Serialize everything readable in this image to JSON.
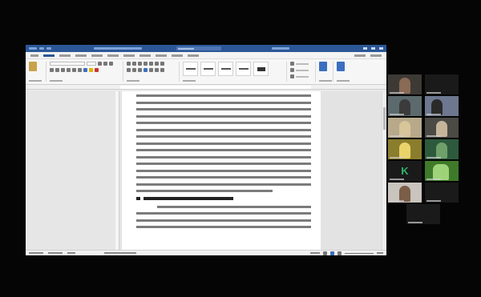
{
  "participants": [
    {
      "letter": ""
    },
    {
      "letter": ""
    },
    {
      "letter": ""
    },
    {
      "letter": ""
    },
    {
      "letter": ""
    },
    {
      "letter": ""
    },
    {
      "letter": ""
    },
    {
      "letter": ""
    },
    {
      "letter": "K"
    },
    {
      "letter": ""
    },
    {
      "letter": ""
    },
    {
      "letter": ""
    },
    {
      "letter": ""
    }
  ]
}
